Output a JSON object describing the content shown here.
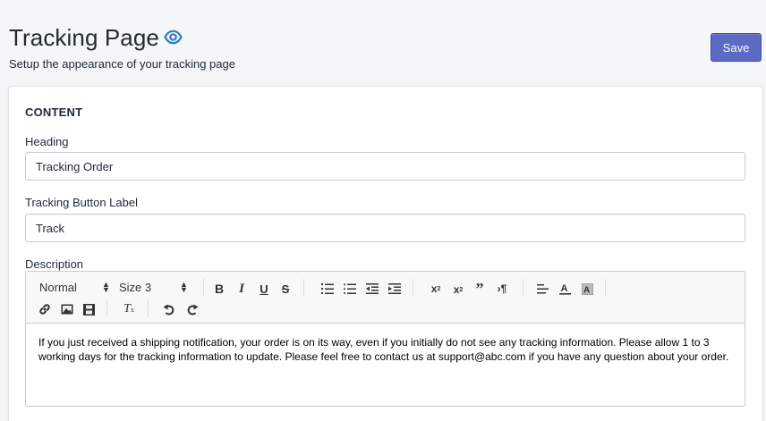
{
  "header": {
    "title": "Tracking Page",
    "subtitle": "Setup the appearance of your tracking page",
    "preview_icon": "eye-icon",
    "save_label": "Save"
  },
  "content": {
    "section_title": "CONTENT",
    "heading": {
      "label": "Heading",
      "value": "Tracking Order"
    },
    "button_label": {
      "label": "Tracking Button Label",
      "value": "Track"
    },
    "description": {
      "label": "Description",
      "toolbar": {
        "format_select": "Normal",
        "size_select": "Size 3",
        "buttons": [
          "bold",
          "italic",
          "underline",
          "strikethrough",
          "ordered-list",
          "unordered-list",
          "outdent",
          "indent",
          "superscript",
          "subscript",
          "blockquote",
          "text-direction",
          "align",
          "font-color",
          "background-color",
          "link",
          "image",
          "video",
          "clear-formatting",
          "undo",
          "redo"
        ]
      },
      "text": "If you just received a shipping notification, your order is on its way, even if you initially do not see any tracking information. Please allow 1 to 3 working days for the tracking information to update. Please feel free to contact us at support@abc.com if you have any question about your order."
    }
  },
  "colors": {
    "primary": "#5c6ac4",
    "eye_icon": "#2e7bc4",
    "background": "#f4f6f8"
  }
}
